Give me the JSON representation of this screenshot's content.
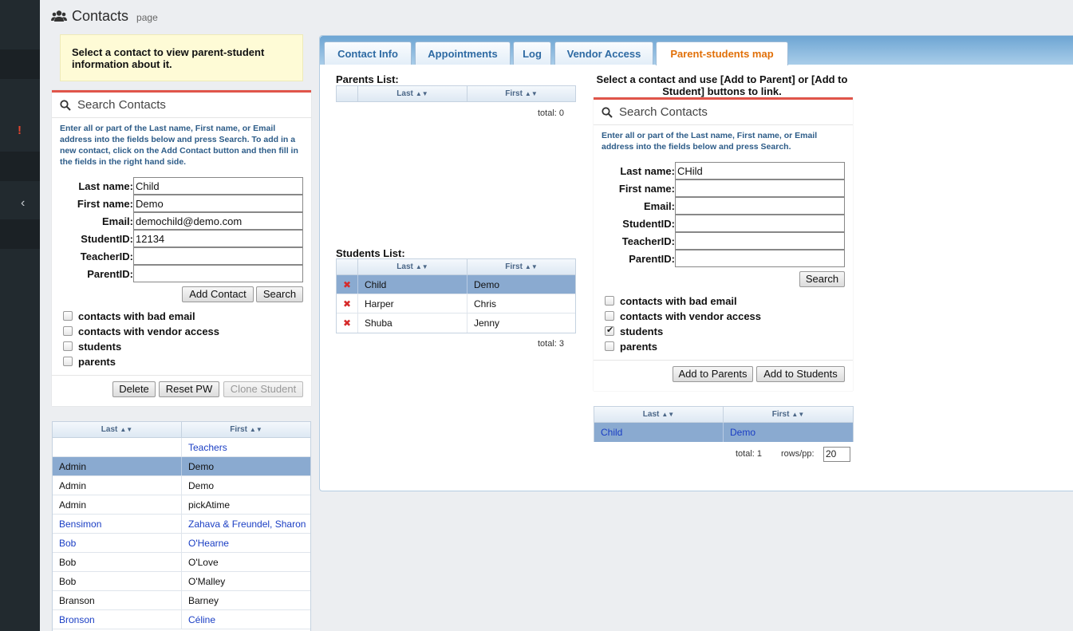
{
  "header": {
    "title": "Contacts",
    "subtitle": "page"
  },
  "hint": "Select a contact to view parent-student information about it.",
  "left_search": {
    "title": "Search Contacts",
    "description": "Enter all or part of the Last name, First name, or Email address into the fields below and press Search. To add in a new contact, click on the Add Contact button and then fill in the fields in the right hand side.",
    "fields": [
      {
        "label": "Last name:",
        "value": "Child"
      },
      {
        "label": "First name:",
        "value": "Demo"
      },
      {
        "label": "Email:",
        "value": "demochild@demo.com"
      },
      {
        "label": "StudentID:",
        "value": "12134"
      },
      {
        "label": "TeacherID:",
        "value": ""
      },
      {
        "label": "ParentID:",
        "value": ""
      }
    ],
    "add_contact_label": "Add Contact",
    "search_label": "Search",
    "checkboxes": [
      {
        "label": "contacts with bad email",
        "checked": false
      },
      {
        "label": "contacts with vendor access",
        "checked": false
      },
      {
        "label": "students",
        "checked": false
      },
      {
        "label": "parents",
        "checked": false
      }
    ],
    "delete_label": "Delete",
    "reset_pw_label": "Reset PW",
    "clone_student_label": "Clone Student"
  },
  "contact_list": {
    "columns": [
      "Last",
      "First"
    ],
    "rows": [
      {
        "last": "",
        "first": "Teachers",
        "link": true,
        "selected": false
      },
      {
        "last": "Admin",
        "first": "Demo",
        "link": false,
        "selected": true
      },
      {
        "last": "Admin",
        "first": "Demo",
        "link": false,
        "selected": false
      },
      {
        "last": "Admin",
        "first": "pickAtime",
        "link": false,
        "selected": false
      },
      {
        "last": "Bensimon",
        "first": "Zahava & Freundel, Sharon",
        "link": true,
        "selected": false
      },
      {
        "last": "Bob",
        "first": "O'Hearne",
        "link": true,
        "selected": false
      },
      {
        "last": "Bob",
        "first": "O'Love",
        "link": false,
        "selected": false
      },
      {
        "last": "Bob",
        "first": "O'Malley",
        "link": false,
        "selected": false
      },
      {
        "last": "Branson",
        "first": "Barney",
        "link": false,
        "selected": false
      },
      {
        "last": "Bronson",
        "first": "Céline",
        "link": true,
        "selected": false
      }
    ]
  },
  "tabs": [
    {
      "label": "Contact Info",
      "active": false
    },
    {
      "label": "Appointments",
      "active": false
    },
    {
      "label": "Log",
      "active": false
    },
    {
      "label": "Vendor Access",
      "active": false
    },
    {
      "label": "Parent-students map",
      "active": true
    }
  ],
  "parents_list": {
    "label": "Parents List:",
    "columns": [
      "Last",
      "First"
    ],
    "rows": [],
    "total": "total: 0"
  },
  "students_list": {
    "label": "Students List:",
    "columns": [
      "Last",
      "First"
    ],
    "rows": [
      {
        "last": "Child",
        "first": "Demo",
        "selected": true
      },
      {
        "last": "Harper",
        "first": "Chris",
        "selected": false
      },
      {
        "last": "Shuba",
        "first": "Jenny",
        "selected": false
      }
    ],
    "total": "total: 3"
  },
  "right_instruction": "Select a contact and use [Add to Parent] or [Add to Student] buttons to link.",
  "right_search": {
    "title": "Search Contacts",
    "description": "Enter all or part of the Last name, First name, or Email address into the fields below and press Search.",
    "fields": [
      {
        "label": "Last name:",
        "value": "CHild"
      },
      {
        "label": "First name:",
        "value": ""
      },
      {
        "label": "Email:",
        "value": ""
      },
      {
        "label": "StudentID:",
        "value": ""
      },
      {
        "label": "TeacherID:",
        "value": ""
      },
      {
        "label": "ParentID:",
        "value": ""
      }
    ],
    "search_label": "Search",
    "checkboxes": [
      {
        "label": "contacts with bad email",
        "checked": false
      },
      {
        "label": "contacts with vendor access",
        "checked": false
      },
      {
        "label": "students",
        "checked": true
      },
      {
        "label": "parents",
        "checked": false
      }
    ],
    "add_parents_label": "Add to Parents",
    "add_students_label": "Add to Students"
  },
  "result_list": {
    "columns": [
      "Last",
      "First"
    ],
    "rows": [
      {
        "last": "Child",
        "first": "Demo",
        "selected": true
      }
    ],
    "total": "total: 1",
    "rows_pp_label": "rows/pp:",
    "rows_pp_value": "20"
  },
  "colors": {
    "accent_red": "#e0554a",
    "tab_active_text": "#e17009",
    "tab_text": "#2e6aa3",
    "selected_row": "#8aaad0",
    "link": "#1a3ec4"
  }
}
